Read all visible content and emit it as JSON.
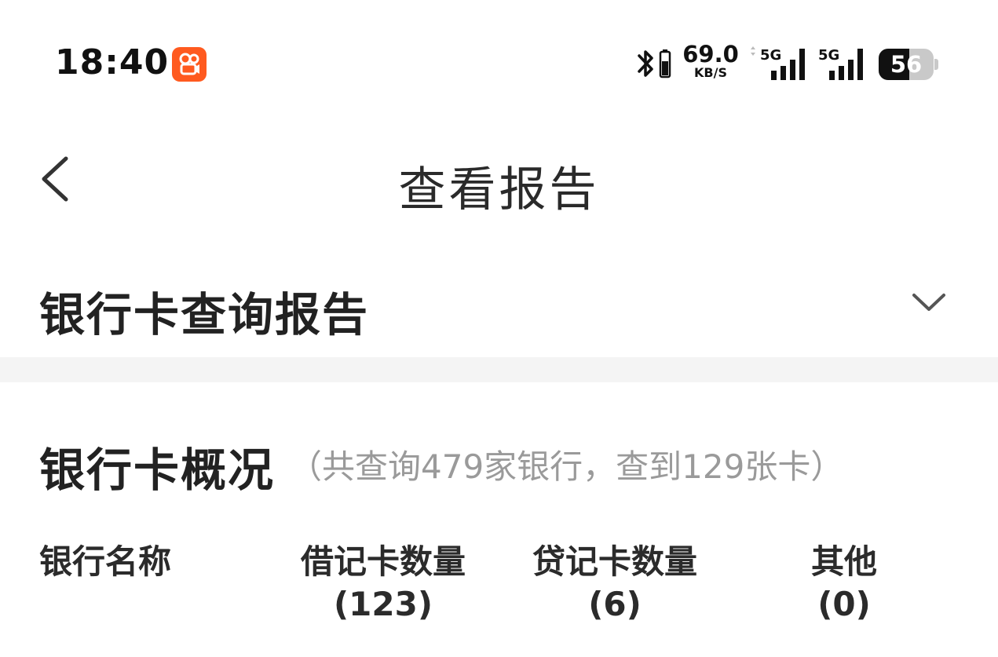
{
  "status_bar": {
    "time": "18:40",
    "app_icon": "kuaishou-app-icon",
    "bluetooth_icon": "bluetooth-icon",
    "net_speed_value": "69.0",
    "net_speed_unit": "KB/S",
    "sim1_label": "5G",
    "sim2_label": "5G",
    "battery_level": "56",
    "battery_fraction": 0.56,
    "accent_color": "#ff5a1f"
  },
  "nav": {
    "back_icon": "chevron-left-icon",
    "title": "查看报告"
  },
  "report": {
    "title": "银行卡查询报告",
    "toggle_icon": "chevron-down-icon"
  },
  "overview": {
    "title": "银行卡概况",
    "summary": "（共查询479家银行，查到129张卡）"
  },
  "table": {
    "headers": [
      {
        "label": "银行名称",
        "count": ""
      },
      {
        "label": "借记卡数量",
        "count": "(123)"
      },
      {
        "label": "贷记卡数量",
        "count": "(6)"
      },
      {
        "label": "其他",
        "count": "(0)"
      }
    ]
  }
}
